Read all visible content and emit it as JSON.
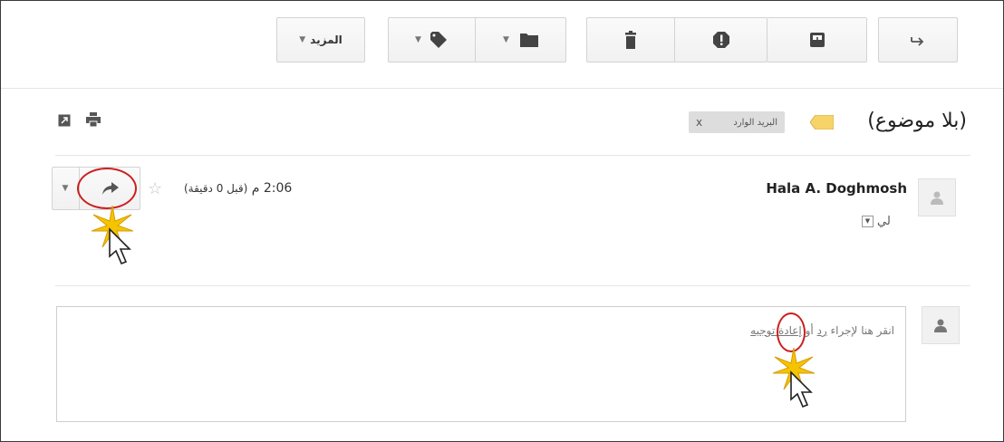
{
  "toolbar": {
    "more_label": "المزيد",
    "archive_icon": "arrow-right-icon",
    "spam_icon": "exclamation-icon",
    "delete_icon": "trash-icon",
    "move_icon": "folder-icon",
    "label_icon": "tag-icon",
    "archive_box_icon": "archive-icon"
  },
  "subject": {
    "title": "(بلا موضوع)",
    "label_chip": "البريد الوارد",
    "chip_close": "x",
    "label_color": "#f6d46a"
  },
  "message": {
    "sender": "Hala A. Doghmosh",
    "to_label": "لي",
    "time": "2:06 م",
    "relative_time": "(قبل 0 دقيقة)"
  },
  "reply": {
    "prompt_prefix": "انقر هنا لإجراء",
    "reply_link": "رد",
    "or": "أو",
    "forward_link": "إعادة توجيه"
  },
  "colors": {
    "accent_red": "#cc1f1f",
    "sparkle": "#f5c400"
  }
}
